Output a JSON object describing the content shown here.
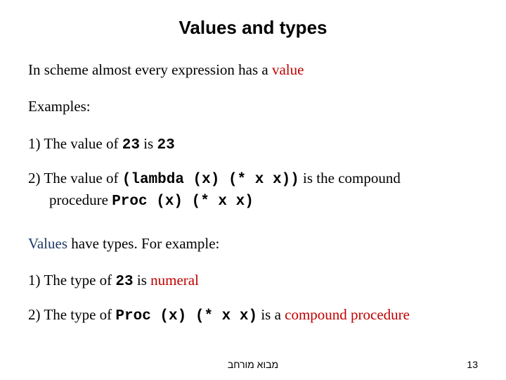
{
  "title": "Values and types",
  "line1_a": "In scheme almost every expression has a ",
  "line1_b": "value",
  "examples_label": "Examples:",
  "ex1_a": "1) The value of ",
  "ex1_code1": "23",
  "ex1_b": " is ",
  "ex1_code2": "23",
  "ex2_a": "2) The value of ",
  "ex2_code1": "(lambda (x) (* x x))",
  "ex2_b": "  is the compound",
  "ex2_c": "procedure ",
  "ex2_code2": "Proc (x) (* x x)",
  "line3_a": "Values",
  "line3_b": " have types. For example:",
  "t1_a": "1) The type of ",
  "t1_code": "23",
  "t1_b": " is ",
  "t1_c": "numeral",
  "t2_a": "2) The type of ",
  "t2_code": "Proc (x) (* x x)",
  "t2_b": "  is a ",
  "t2_c": "compound procedure",
  "footer": "מבוא מורחב",
  "page": "13"
}
